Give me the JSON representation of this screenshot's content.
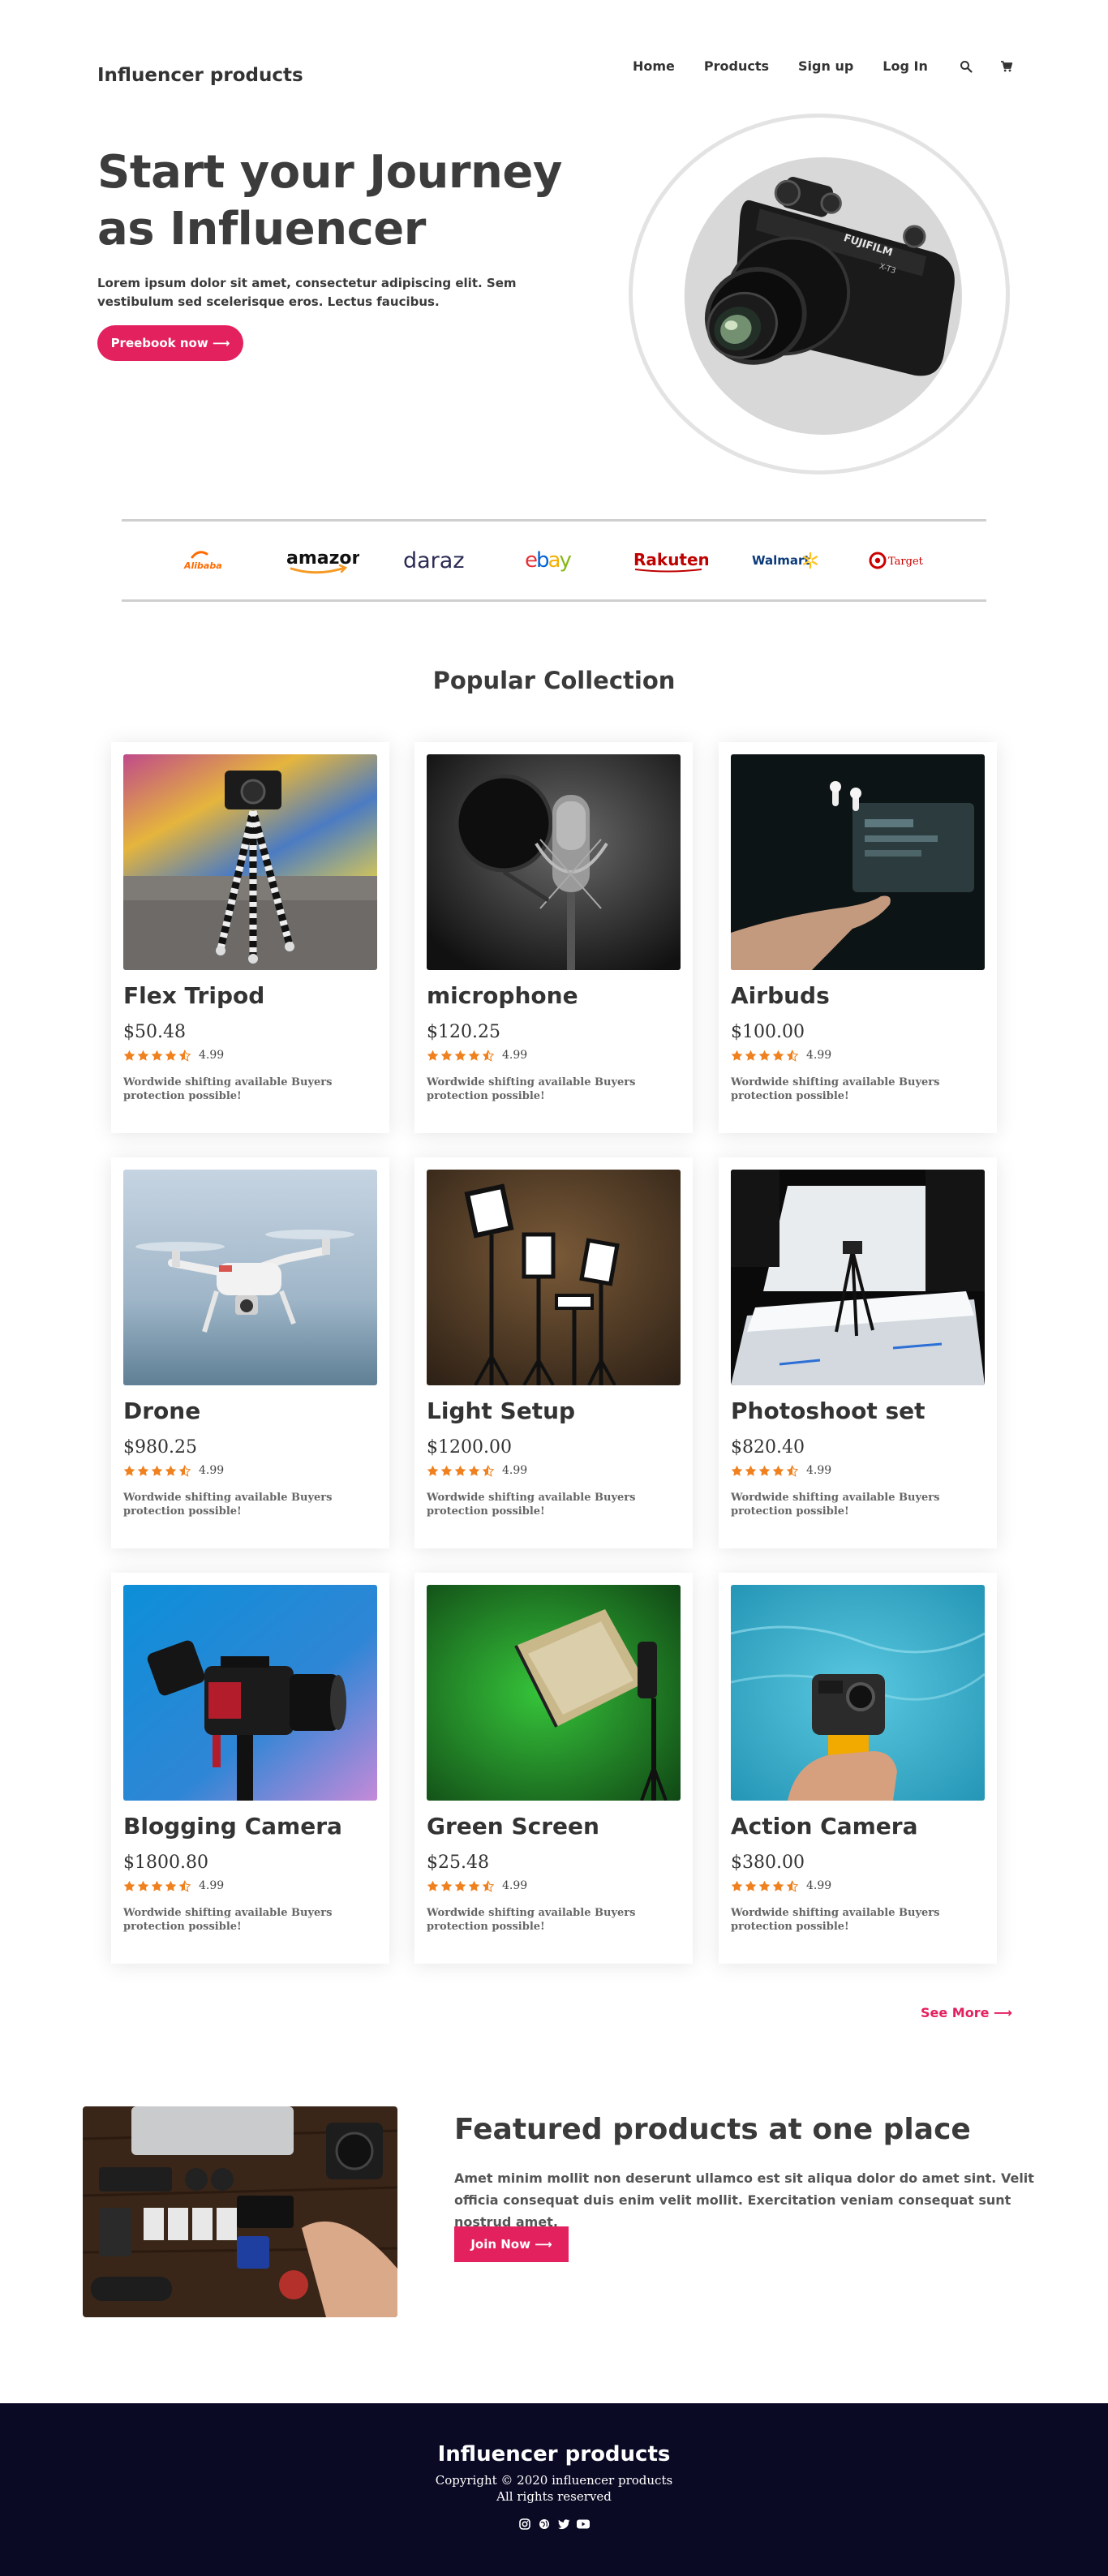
{
  "navbar": {
    "brand": "Influencer products",
    "links": [
      "Home",
      "Products",
      "Sign up",
      "Log In"
    ],
    "icons": [
      "search-icon",
      "cart-icon"
    ]
  },
  "hero": {
    "title": "Start your Journey as Influencer",
    "text": "Lorem ipsum dolor sit amet, consectetur adipiscing elit. Sem vestibulum sed scelerisque eros. Lectus faucibus.",
    "button_label": "Preebook now ⟶",
    "image_alt": "Fujifilm X-T3 mirrorless camera",
    "camera_brand": "FUJIFILM",
    "camera_model": "X-T3"
  },
  "brands": [
    "Alibaba",
    "amazon",
    "daraz",
    "ebay",
    "Rakuten",
    "Walmart",
    "Target"
  ],
  "colors": {
    "accent": "#e3215f",
    "footer_bg": "#0b0a25",
    "star": "#f0811f",
    "text": "#3a3a3a"
  },
  "collection": {
    "title": "Popular Collection",
    "products": [
      {
        "name": "Flex Tripod",
        "price": "$50.48",
        "rating": "4.99",
        "stars": 4.5,
        "shipping": "Wordwide shifting available Buyers protection possible!"
      },
      {
        "name": "microphone",
        "price": "$120.25",
        "rating": "4.99",
        "stars": 4.5,
        "shipping": "Wordwide shifting available Buyers protection possible!"
      },
      {
        "name": "Airbuds",
        "price": "$100.00",
        "rating": "4.99",
        "stars": 4.5,
        "shipping": "Wordwide shifting available Buyers protection possible!"
      },
      {
        "name": "Drone",
        "price": "$980.25",
        "rating": "4.99",
        "stars": 4.5,
        "shipping": "Wordwide shifting available Buyers protection possible!"
      },
      {
        "name": "Light Setup",
        "price": "$1200.00",
        "rating": "4.99",
        "stars": 4.5,
        "shipping": "Wordwide shifting available Buyers protection possible!"
      },
      {
        "name": "Photoshoot set",
        "price": "$820.40",
        "rating": "4.99",
        "stars": 4.5,
        "shipping": "Wordwide shifting available Buyers protection possible!"
      },
      {
        "name": "Blogging Camera",
        "price": "$1800.80",
        "rating": "4.99",
        "stars": 4.5,
        "shipping": "Wordwide shifting available Buyers protection possible!"
      },
      {
        "name": "Green Screen",
        "price": "$25.48",
        "rating": "4.99",
        "stars": 4.5,
        "shipping": "Wordwide shifting available Buyers protection possible!"
      },
      {
        "name": "Action Camera",
        "price": "$380.00",
        "rating": "4.99",
        "stars": 4.5,
        "shipping": "Wordwide shifting available Buyers protection possible!"
      }
    ],
    "see_more": "See More ⟶"
  },
  "featured": {
    "title": "Featured products at one place",
    "text": "Amet minim mollit non deserunt ullamco est sit aliqua dolor do amet sint. Velit officia consequat duis enim velit mollit. Exercitation veniam consequat sunt nostrud amet.",
    "button_label": "Join Now ⟶"
  },
  "footer": {
    "brand": "Influencer products",
    "copyright": "Copyright © 2020 influencer products",
    "rights": "All rights reserved",
    "socials": [
      "instagram-icon",
      "globe-icon",
      "twitter-icon",
      "youtube-icon"
    ]
  }
}
